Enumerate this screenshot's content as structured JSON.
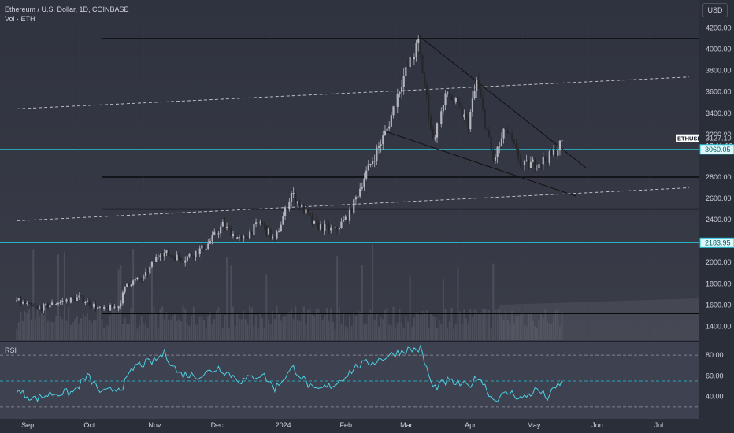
{
  "header": {
    "title": "Ethereum / U.S. Dollar, 1D, COINBASE",
    "volume_label": "Vol · ETH",
    "currency_button": "USD"
  },
  "price_tags": {
    "symbol": "ETHUSD",
    "last_price": "3127.10",
    "countdown": "18:11:12",
    "level_high": "3060.05",
    "level_low": "2183.95"
  },
  "rsi_panel": {
    "label": "RSI"
  },
  "colors": {
    "background": "#2a2e39",
    "up": "#b2b5be",
    "down": "#26262a",
    "cyan": "#26c6da",
    "rsi": "#4dd0e1",
    "level": "#000000"
  },
  "chart_data": [
    {
      "type": "candlestick",
      "title": "Ethereum / U.S. Dollar, 1D, COINBASE",
      "x_ticks": [
        "Sep",
        "Oct",
        "Nov",
        "Dec",
        "2024",
        "Feb",
        "Mar",
        "Apr",
        "May",
        "Jun",
        "Jul"
      ],
      "y_ticks": [
        "4200.00",
        "4000.00",
        "3800.00",
        "3600.00",
        "3400.00",
        "3200.00",
        "2800.00",
        "2600.00",
        "2400.00",
        "2000.00",
        "1800.00",
        "1600.00",
        "1400.00"
      ],
      "ylim": [
        1270,
        4300
      ],
      "price_path": [
        [
          "2023-09-01",
          1640
        ],
        [
          "2023-09-11",
          1560
        ],
        [
          "2023-09-20",
          1620
        ],
        [
          "2023-10-01",
          1670
        ],
        [
          "2023-10-12",
          1550
        ],
        [
          "2023-10-20",
          1590
        ],
        [
          "2023-10-24",
          1800
        ],
        [
          "2023-11-01",
          1850
        ],
        [
          "2023-11-09",
          2100
        ],
        [
          "2023-11-20",
          2030
        ],
        [
          "2023-12-01",
          2150
        ],
        [
          "2023-12-09",
          2350
        ],
        [
          "2023-12-18",
          2200
        ],
        [
          "2023-12-27",
          2380
        ],
        [
          "2024-01-03",
          2200
        ],
        [
          "2024-01-11",
          2650
        ],
        [
          "2024-01-22",
          2350
        ],
        [
          "2024-02-01",
          2300
        ],
        [
          "2024-02-08",
          2450
        ],
        [
          "2024-02-15",
          2800
        ],
        [
          "2024-02-26",
          3250
        ],
        [
          "2024-03-04",
          3700
        ],
        [
          "2024-03-12",
          4050
        ],
        [
          "2024-03-19",
          3150
        ],
        [
          "2024-03-26",
          3600
        ],
        [
          "2024-04-05",
          3300
        ],
        [
          "2024-04-09",
          3700
        ],
        [
          "2024-04-17",
          2950
        ],
        [
          "2024-04-23",
          3250
        ],
        [
          "2024-05-01",
          2900
        ],
        [
          "2024-05-10",
          2950
        ],
        [
          "2024-05-15",
          3000
        ],
        [
          "2024-05-20",
          3127
        ]
      ],
      "volume_level": "relative",
      "horizontal_levels": [
        4100,
        2800,
        2500,
        1520
      ],
      "highlighted_levels": [
        3060.05,
        2183.95
      ],
      "trendlines": [
        {
          "from": [
            "2024-03-12",
            4130
          ],
          "to": [
            "2024-06-01",
            2880
          ],
          "style": "solid"
        },
        {
          "from": [
            "2024-02-25",
            3230
          ],
          "to": [
            "2024-05-27",
            2620
          ],
          "style": "solid"
        },
        {
          "from": [
            "2023-09-01",
            3440
          ],
          "to": [
            "2024-07-20",
            3740
          ],
          "style": "dashed"
        },
        {
          "from": [
            "2023-09-01",
            2390
          ],
          "to": [
            "2024-07-20",
            2700
          ],
          "style": "dashed"
        }
      ]
    },
    {
      "type": "line",
      "name": "RSI",
      "y_ticks": [
        "80.00",
        "60.00",
        "40.00"
      ],
      "ylim": [
        20,
        90
      ],
      "bands": [
        30,
        55,
        80
      ],
      "path": [
        [
          "2023-09-01",
          45
        ],
        [
          "2023-09-10",
          38
        ],
        [
          "2023-09-18",
          43
        ],
        [
          "2023-09-28",
          44
        ],
        [
          "2023-10-05",
          60
        ],
        [
          "2023-10-12",
          43
        ],
        [
          "2023-10-22",
          50
        ],
        [
          "2023-10-28",
          70
        ],
        [
          "2023-11-06",
          74
        ],
        [
          "2023-11-11",
          82
        ],
        [
          "2023-11-18",
          62
        ],
        [
          "2023-11-28",
          60
        ],
        [
          "2023-12-07",
          68
        ],
        [
          "2023-12-18",
          55
        ],
        [
          "2023-12-28",
          62
        ],
        [
          "2024-01-03",
          48
        ],
        [
          "2024-01-12",
          68
        ],
        [
          "2024-01-22",
          45
        ],
        [
          "2024-02-01",
          52
        ],
        [
          "2024-02-12",
          70
        ],
        [
          "2024-02-20",
          74
        ],
        [
          "2024-03-01",
          82
        ],
        [
          "2024-03-06",
          85
        ],
        [
          "2024-03-13",
          86
        ],
        [
          "2024-03-19",
          48
        ],
        [
          "2024-03-26",
          55
        ],
        [
          "2024-04-05",
          50
        ],
        [
          "2024-04-10",
          60
        ],
        [
          "2024-04-17",
          37
        ],
        [
          "2024-04-25",
          44
        ],
        [
          "2024-05-01",
          38
        ],
        [
          "2024-05-08",
          47
        ],
        [
          "2024-05-13",
          39
        ],
        [
          "2024-05-20",
          55
        ]
      ]
    }
  ]
}
